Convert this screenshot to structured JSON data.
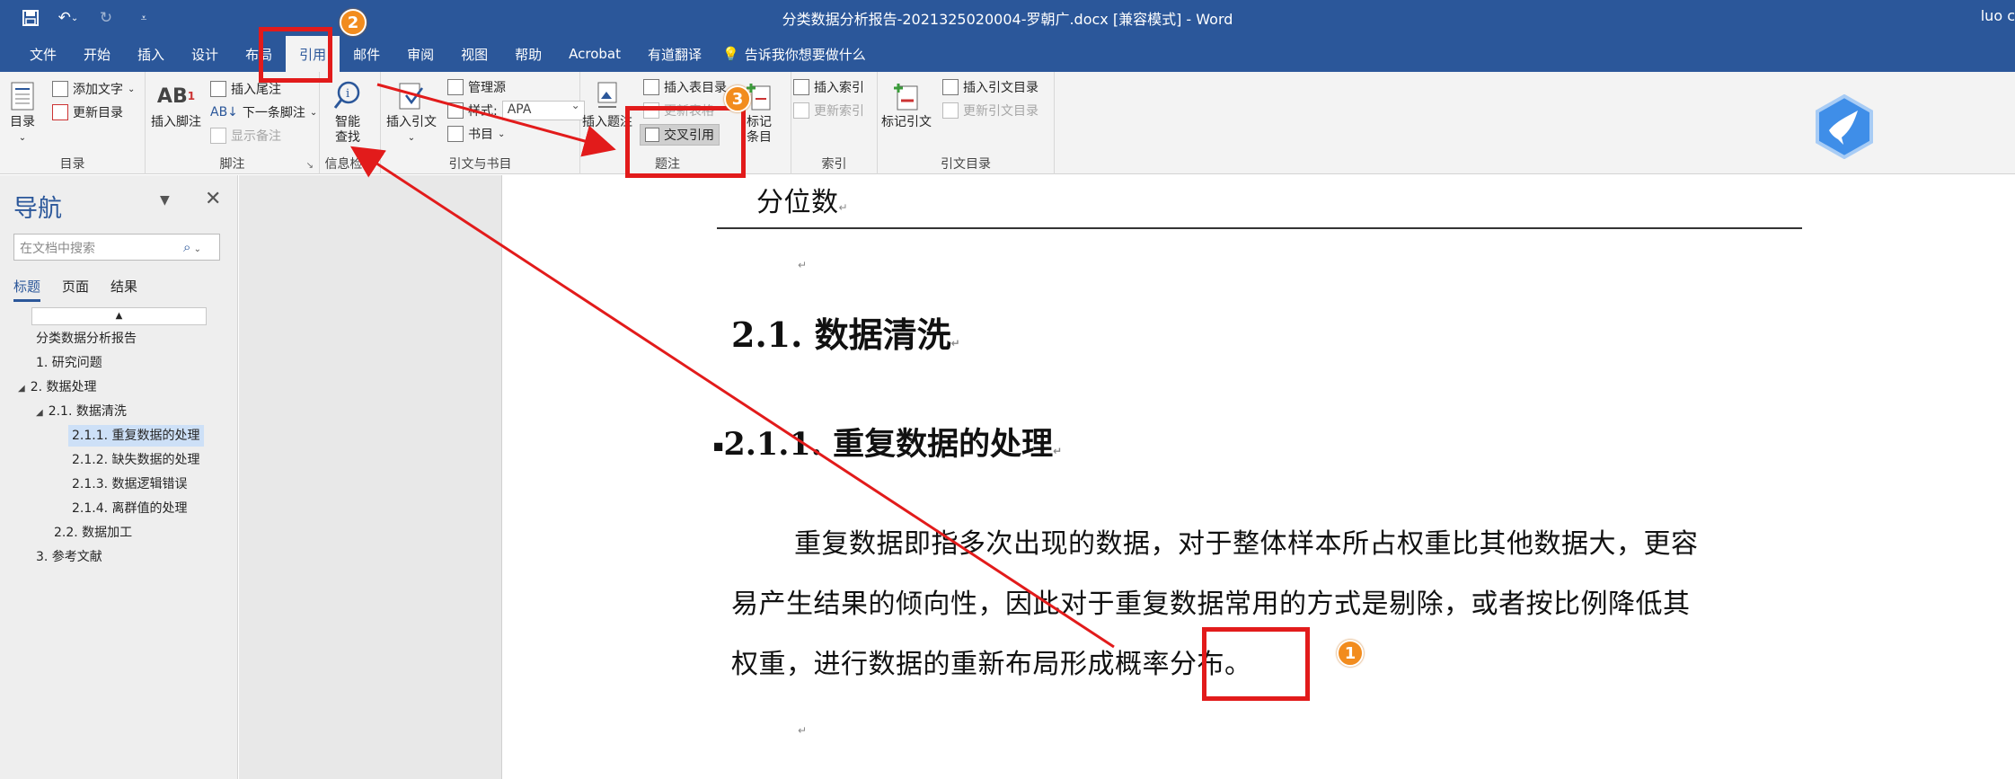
{
  "window": {
    "title": "分类数据分析报告-2021325020004-罗朝广.docx [兼容模式] - Word",
    "user": "luo c"
  },
  "tabs": [
    "文件",
    "开始",
    "插入",
    "设计",
    "布局",
    "引用",
    "邮件",
    "审阅",
    "视图",
    "帮助",
    "Acrobat",
    "有道翻译"
  ],
  "active_tab": "引用",
  "tell_me": "告诉我你想要做什么",
  "ribbon": {
    "toc": {
      "big": "目录",
      "add_text": "添加文字",
      "update": "更新目录",
      "label": "目录"
    },
    "footnote": {
      "big": "插入脚注",
      "endnote": "插入尾注",
      "next": "下一条脚注",
      "show": "显示备注",
      "label": "脚注"
    },
    "research": {
      "big": "智能\n查找",
      "big_line1": "智能",
      "big_line2": "查找",
      "label": "信息检索"
    },
    "citations": {
      "big": "插入引文",
      "manage": "管理源",
      "style_label": "样式:",
      "style_value": "APA",
      "biblio": "书目",
      "label": "引文与书目"
    },
    "captions": {
      "big": "插入题注",
      "insert_table": "插入表目录",
      "update_table": "更新表格",
      "cross_ref": "交叉引用",
      "label": "题注"
    },
    "index": {
      "big_line1": "标记",
      "big_line2": "条目",
      "insert": "插入索引",
      "update": "更新索引",
      "label": "索引"
    },
    "toa": {
      "big": "标记引文",
      "insert": "插入引文目录",
      "update": "更新引文目录",
      "label": "引文目录"
    }
  },
  "nav": {
    "title": "导航",
    "search_placeholder": "在文档中搜索",
    "tabs": [
      "标题",
      "页面",
      "结果"
    ],
    "tree": [
      {
        "text": "分类数据分析报告",
        "level": 0
      },
      {
        "text": "1. 研究问题",
        "level": 0
      },
      {
        "text": "2. 数据处理",
        "level": 0
      },
      {
        "text": "2.1. 数据清洗",
        "level": 1
      },
      {
        "text": "2.1.1. 重复数据的处理",
        "level": 2
      },
      {
        "text": "2.1.2. 缺失数据的处理",
        "level": 2
      },
      {
        "text": "2.1.3. 数据逻辑错误",
        "level": 2
      },
      {
        "text": "2.1.4. 离群值的处理",
        "level": 2
      },
      {
        "text": "2.2. 数据加工",
        "level": 1
      },
      {
        "text": "3. 参考文献",
        "level": 0
      }
    ]
  },
  "document": {
    "top_fragment": "分位数",
    "heading2": "2.1.  数据清洗",
    "heading3": "2.1.1.  重复数据的处理",
    "para_line1": "重复数据即指多次出现的数据，对于整体样本所占权重比其他数据大，更容",
    "para_line2": "易产生结果的倾向性，因此对于重复数据常用的方式是剔除，或者按比例降低其",
    "para_line3": "权重，进行数据的重新布局形成概率分布。"
  },
  "annotations": {
    "badge1": "1",
    "badge2": "2",
    "badge3": "3",
    "color": "#e21b1b",
    "badge_color": "#f28c1e"
  },
  "colors": {
    "word_blue": "#2b579a"
  }
}
